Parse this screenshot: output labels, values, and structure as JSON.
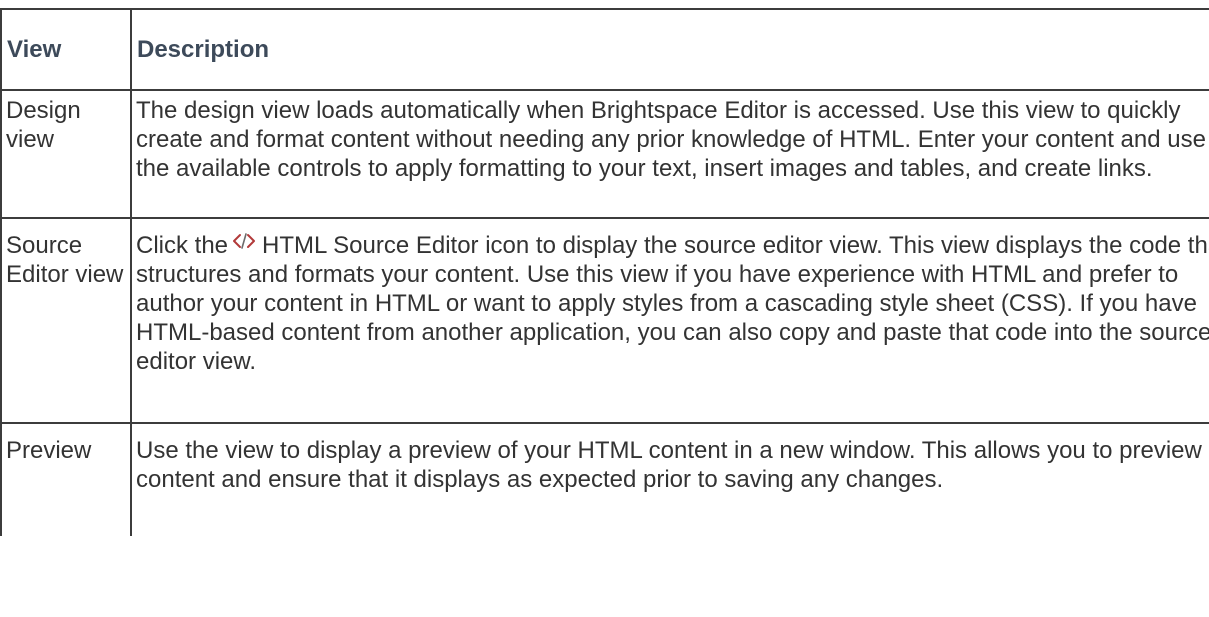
{
  "table": {
    "headers": {
      "view": "View",
      "description": "Description"
    },
    "rows": [
      {
        "view": "Design view",
        "description": "The design view loads automatically when Brightspace Editor is accessed. Use this view to quickly create and format content without needing any prior knowledge of HTML. Enter your content and use the available controls to apply formatting to your text, insert images and tables, and create links."
      },
      {
        "view": "Source Editor view",
        "description_before": "Click the",
        "description_icon": "html-source-editor-icon",
        "description_after": "HTML Source Editor icon to display the source editor view. This view displays the code that structures and formats your content. Use this view if you have experience with HTML and prefer to author your content in HTML or want to apply styles from a cascading style sheet (CSS). If you have HTML-based content from another application, you can also copy and paste that code into the source editor view."
      },
      {
        "view": "Preview",
        "description": "Use the view to display a preview of your HTML content in a new window. This allows you to preview content and ensure that it displays as expected prior to saving any changes."
      }
    ]
  },
  "colors": {
    "border": "#3c3c3c",
    "header_text": "#3d4a5a",
    "body_text": "#333333"
  }
}
